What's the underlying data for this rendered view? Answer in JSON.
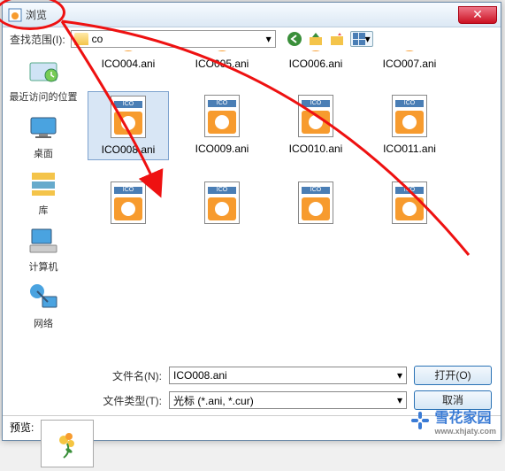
{
  "titlebar": {
    "title": "浏览"
  },
  "topbar": {
    "lookin_label": "查找范围(I):",
    "current_folder": "co"
  },
  "sidebar": {
    "items": [
      {
        "label": "最近访问的位置"
      },
      {
        "label": "桌面"
      },
      {
        "label": "库"
      },
      {
        "label": "计算机"
      },
      {
        "label": "网络"
      }
    ]
  },
  "files": {
    "row1": [
      "ICO004.ani",
      "ICO005.ani",
      "ICO006.ani",
      "ICO007.ani"
    ],
    "row2": [
      "ICO008.ani",
      "ICO009.ani",
      "ICO010.ani",
      "ICO011.ani"
    ],
    "selected": "ICO008.ani",
    "icon_band": "ICO"
  },
  "bottom": {
    "filename_label": "文件名(N):",
    "filename_value": "ICO008.ani",
    "filetype_label": "文件类型(T):",
    "filetype_value": "光标 (*.ani, *.cur)",
    "open_label": "打开(O)",
    "cancel_label": "取消"
  },
  "preview": {
    "label": "预览:"
  },
  "watermark": {
    "text": "雪花家园",
    "url": "www.xhjaty.com"
  }
}
